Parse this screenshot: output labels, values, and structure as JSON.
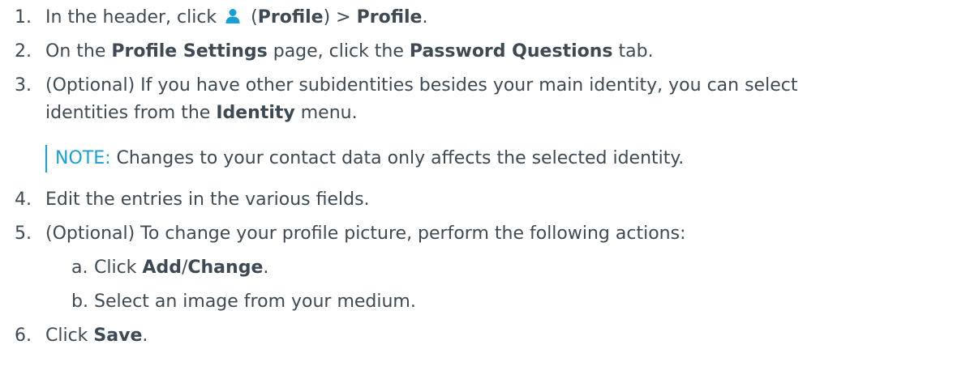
{
  "steps": [
    {
      "num": "1.",
      "pre": "In the header, click ",
      "icon": "profile-person-icon",
      "paren_open": " (",
      "b1": "Profile",
      "mid": ") > ",
      "b2": "Profile",
      "post": "."
    },
    {
      "num": "2.",
      "pre": "On the ",
      "b1": "Profile Settings",
      "mid": " page, click the ",
      "b2": "Password Questions",
      "post": " tab."
    },
    {
      "num": "3.",
      "line1": "(Optional) If you have other subidentities besides your main identity, you can select",
      "line2_pre": "identities from the ",
      "b1": "Identity",
      "line2_post": " menu."
    },
    {
      "num": "4.",
      "text": "Edit the entries in the various fields."
    },
    {
      "num": "5.",
      "text": "(Optional) To change your profile picture, perform the following actions:"
    },
    {
      "num": "6.",
      "pre": "Click ",
      "b1": "Save",
      "post": "."
    }
  ],
  "note": {
    "label": "NOTE:",
    "text": " Changes to your contact data only affects the selected identity."
  },
  "substeps": [
    {
      "letter": "a.",
      "pre": "Click ",
      "b1": "Add",
      "mid": "/",
      "b2": "Change",
      "post": "."
    },
    {
      "letter": "b.",
      "text": "Select an image from your medium."
    }
  ],
  "colors": {
    "text": "#3d4a54",
    "accent": "#18a0d6"
  }
}
